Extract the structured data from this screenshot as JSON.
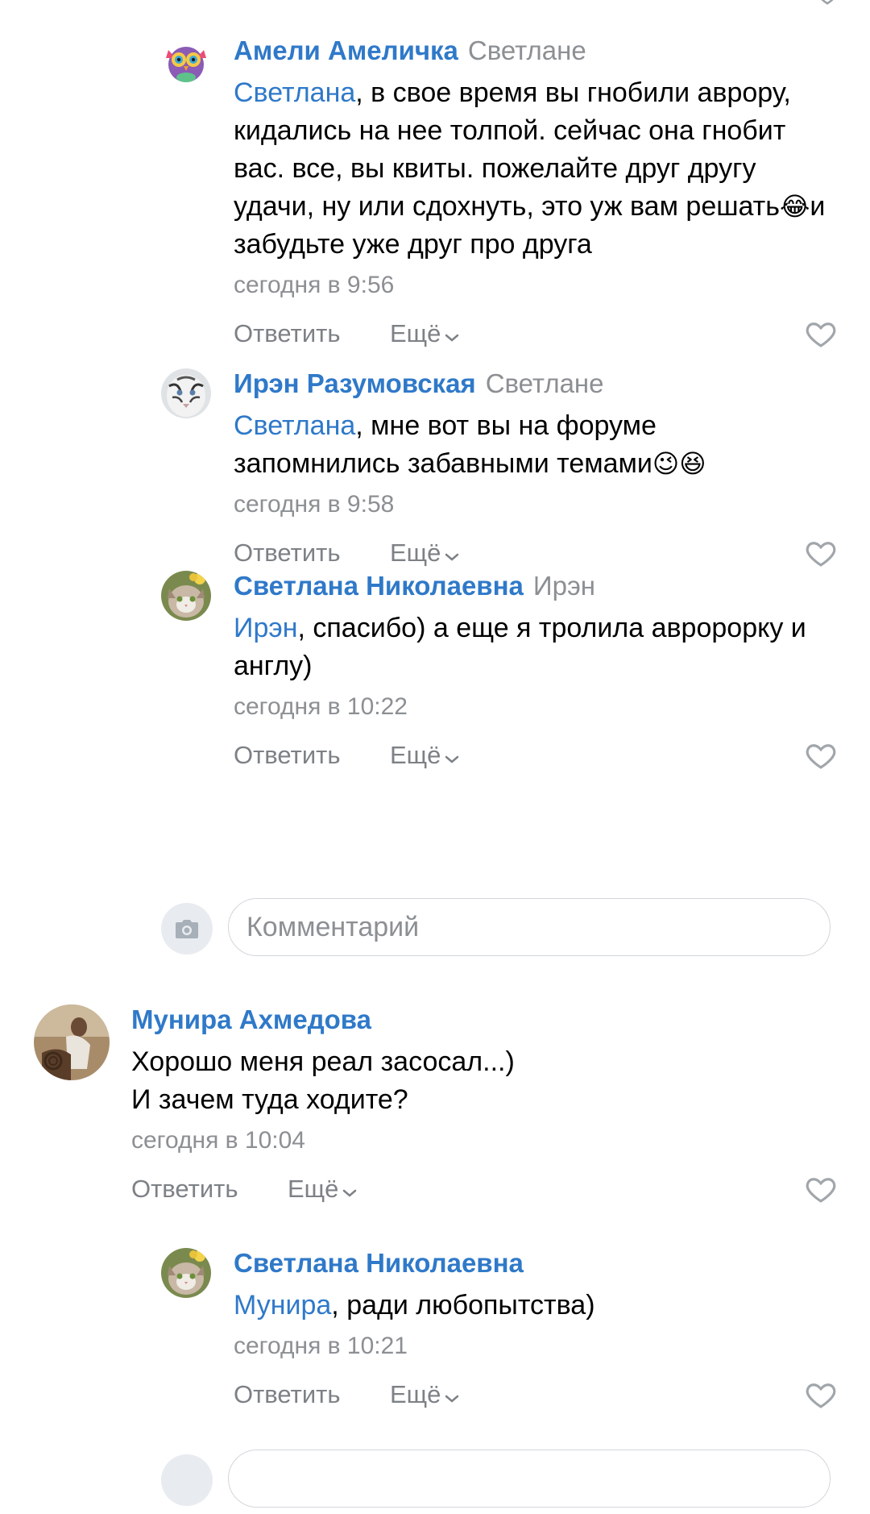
{
  "comments": [
    {
      "author": "Амели Амеличка",
      "addressee": "Светлане",
      "mention": "Светлана",
      "text_before_emoji": ", в свое время вы гнобили аврору, кидались на нее толпой. сейчас она гнобит вас. все, вы квиты. пожелайте друг другу удачи, ну или сдохнуть, это уж вам решать",
      "emoji": "😂",
      "text_after_emoji": "и забудьте уже друг про друга",
      "time": "сегодня в 9:56",
      "reply_label": "Ответить",
      "more_label": "Ещё"
    },
    {
      "author": "Ирэн Разумовская",
      "addressee": "Светлане",
      "mention": "Светлана",
      "text": ", мне вот вы на форуме запомнились забавными темами",
      "emoji": "😉😆",
      "time": "сегодня в 9:58",
      "reply_label": "Ответить",
      "more_label": "Ещё"
    },
    {
      "author": "Светлана Николаевна",
      "addressee": "Ирэн",
      "mention": "Ирэн",
      "text": ", спасибо) а еще я тролила авророрку и англу)",
      "time": "сегодня в 10:22",
      "reply_label": "Ответить",
      "more_label": "Ещё"
    },
    {
      "author": "Мунира Ахмедова",
      "line1": "Хорошо меня реал засосал...)",
      "line2": "И зачем туда ходите?",
      "time": "сегодня в 10:04",
      "reply_label": "Ответить",
      "more_label": "Ещё"
    },
    {
      "author": "Светлана Николаевна",
      "mention": "Мунира",
      "text": ", ради любопытства)",
      "time": "сегодня в 10:21",
      "reply_label": "Ответить",
      "more_label": "Ещё"
    }
  ],
  "composer": {
    "placeholder": "Комментарий"
  },
  "colors": {
    "link": "#2f79c9",
    "muted": "#8c8f93",
    "action": "#7d8186"
  },
  "icons": [
    "camera-icon",
    "heart-icon",
    "chevron-down-icon"
  ]
}
